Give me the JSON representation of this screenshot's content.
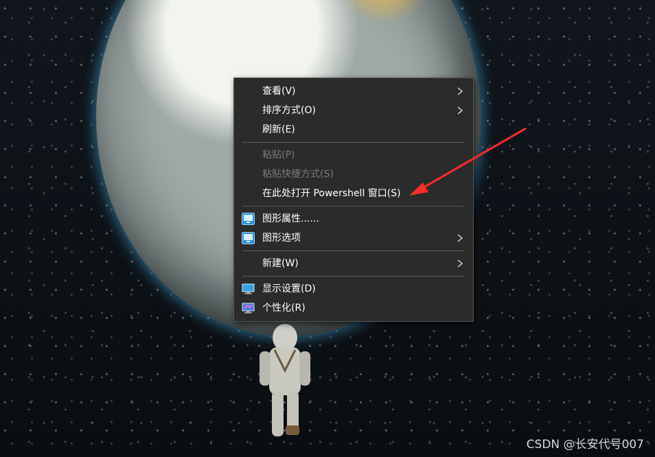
{
  "menu": {
    "view": "查看(V)",
    "sort": "排序方式(O)",
    "refresh": "刷新(E)",
    "paste": "粘贴(P)",
    "paste_shortcut": "粘贴快捷方式(S)",
    "open_powershell": "在此处打开 Powershell 窗口(S)",
    "graphics_properties": "图形属性......",
    "graphics_options": "图形选项",
    "new": "新建(W)",
    "display_settings": "显示设置(D)",
    "personalize": "个性化(R)"
  },
  "watermark": "CSDN @长安代号007",
  "colors": {
    "menu_bg": "#2b2b2b",
    "annotation_arrow": "#ff2a2a",
    "disabled_text": "#7a7a7a"
  }
}
